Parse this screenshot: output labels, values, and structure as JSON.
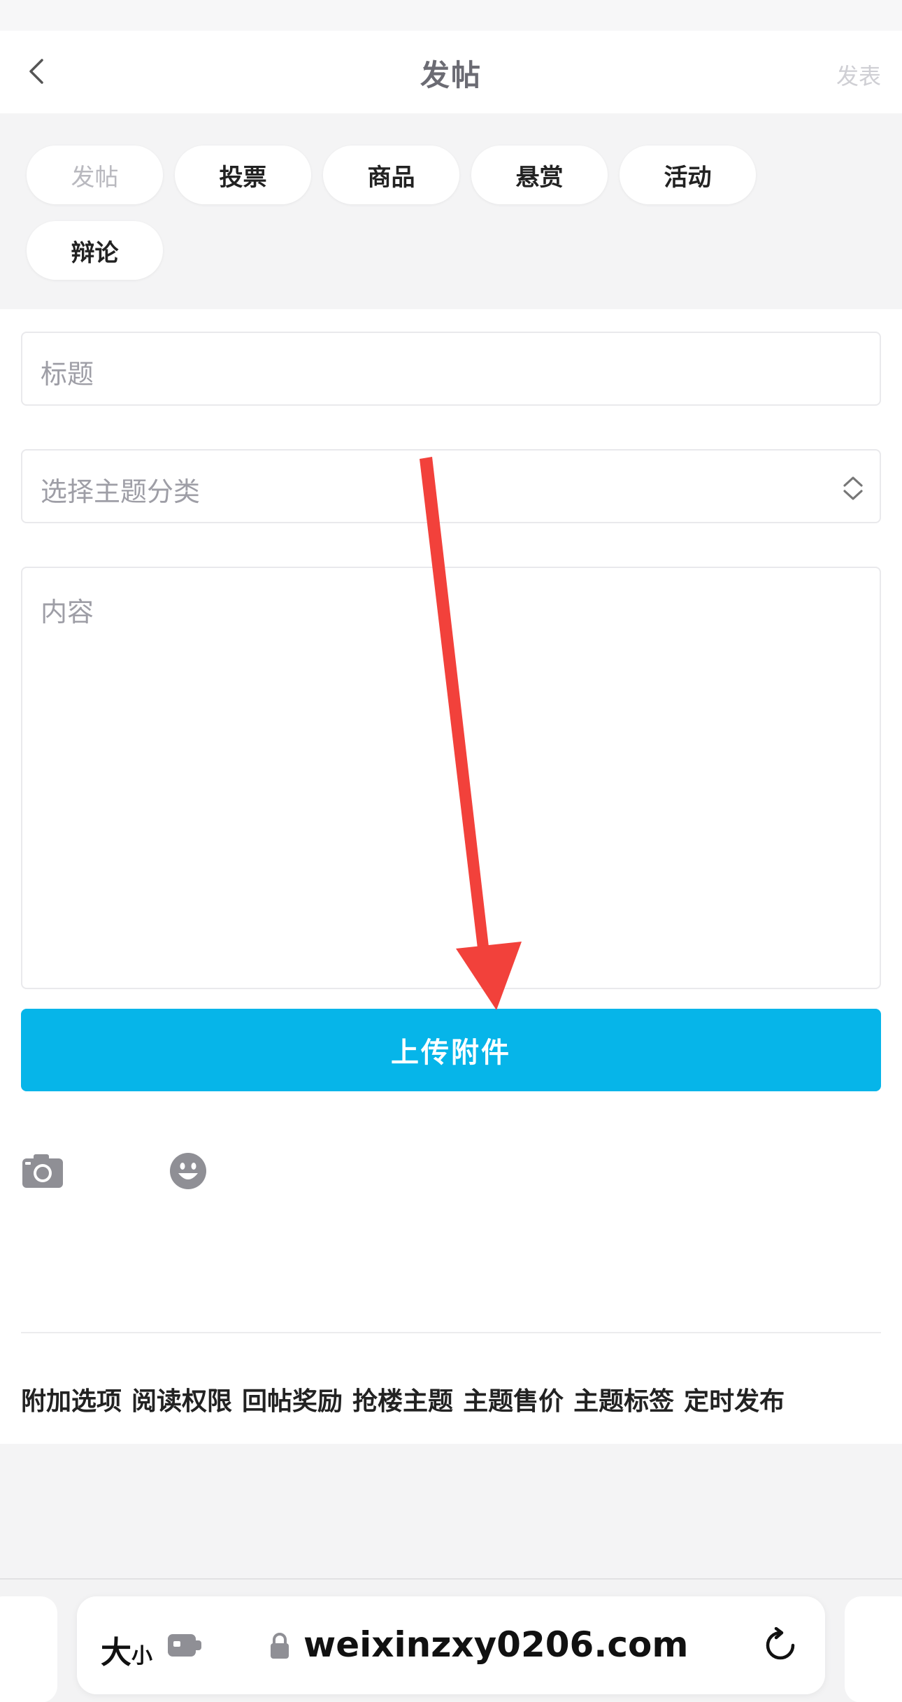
{
  "header": {
    "title": "发帖",
    "publish_label": "发表"
  },
  "post_types": [
    {
      "label": "发帖",
      "active": true
    },
    {
      "label": "投票",
      "active": false
    },
    {
      "label": "商品",
      "active": false
    },
    {
      "label": "悬赏",
      "active": false
    },
    {
      "label": "活动",
      "active": false
    },
    {
      "label": "辩论",
      "active": false
    }
  ],
  "form": {
    "title_placeholder": "标题",
    "category_placeholder": "选择主题分类",
    "content_placeholder": "内容",
    "upload_label": "上传附件"
  },
  "toolbar": {
    "camera_icon": "camera-icon",
    "emoji_icon": "emoji-icon"
  },
  "options": [
    "附加选项",
    "阅读权限",
    "回帖奖励",
    "抢楼主题",
    "主题售价",
    "主题标签",
    "定时发布"
  ],
  "browser": {
    "text_size_big": "大",
    "text_size_small": "小",
    "url": "weixinzxy0206.com"
  },
  "colors": {
    "accent": "#06b5e9",
    "annotation_arrow": "#f2413b"
  }
}
